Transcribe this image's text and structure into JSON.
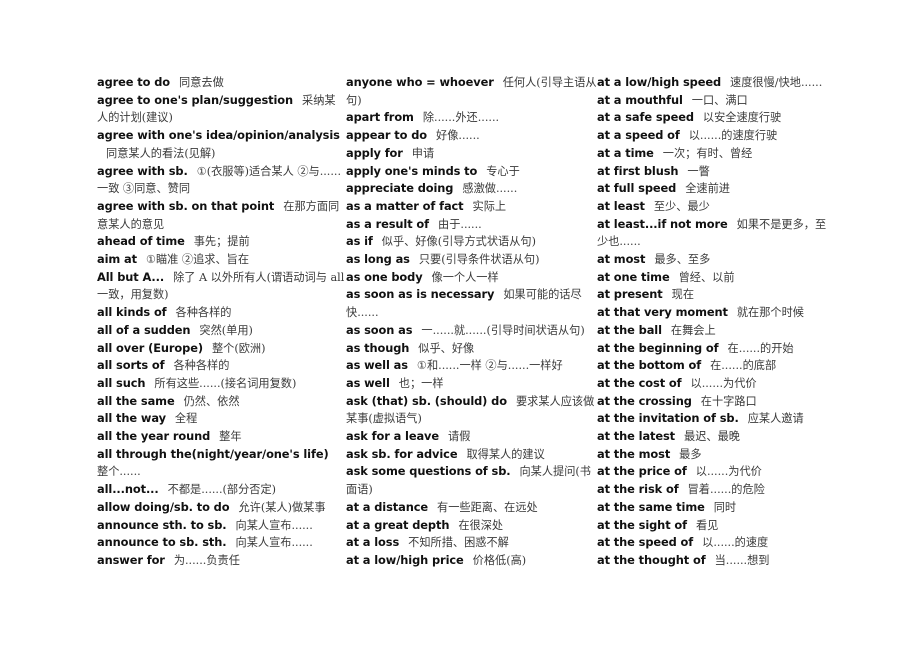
{
  "document": {
    "page_background": "#ffffff",
    "english_color": "#111111",
    "chinese_color": "#3a3a3a",
    "columns": [
      {
        "id": "column-1",
        "entries": [
          {
            "en": "agree to do",
            "zh": "同意去做"
          },
          {
            "en": "agree to one's plan/suggestion",
            "zh": "采纳某人的计划(建议)"
          },
          {
            "en": "agree with one's idea/opinion/analysis",
            "zh": "同意某人的看法(见解)"
          },
          {
            "en": "agree with sb.",
            "zh": "①(衣服等)适合某人  ②与......一致 ③同意、赞同"
          },
          {
            "en": "agree with sb. on that point",
            "zh": "在那方面同意某人的意见"
          },
          {
            "en": "ahead of time",
            "zh": "事先；提前"
          },
          {
            "en": "aim at",
            "zh": "①瞄准 ②追求、旨在"
          },
          {
            "en": "All but A...",
            "zh": "除了 A 以外所有人(谓语动词与 all 一致，用复数)"
          },
          {
            "en": "all kinds of",
            "zh": "各种各样的"
          },
          {
            "en": "all of a sudden",
            "zh": "突然(单用)"
          },
          {
            "en": "all over (Europe)",
            "zh": "整个(欧洲)"
          },
          {
            "en": "all sorts of",
            "zh": "各种各样的"
          },
          {
            "en": "all such",
            "zh": "所有这些......(接名词用复数)"
          },
          {
            "en": "all the same",
            "zh": "仍然、依然"
          },
          {
            "en": "all the way",
            "zh": "全程"
          },
          {
            "en": "all the year round",
            "zh": "整年"
          },
          {
            "en": "all through the(night/year/one's life)",
            "zh": "整个......"
          },
          {
            "en": "all...not...",
            "zh": "不都是......(部分否定)"
          },
          {
            "en": "allow doing/sb. to do",
            "zh": "允许(某人)做某事"
          },
          {
            "en": "announce sth. to sb.",
            "zh": "向某人宣布......"
          },
          {
            "en": "announce to sb. sth.",
            "zh": "向某人宣布......"
          },
          {
            "en": "answer for",
            "zh": "为......负责任"
          }
        ]
      },
      {
        "id": "column-2",
        "entries": [
          {
            "en": "anyone who = whoever",
            "zh": "任何人(引导主语从句)"
          },
          {
            "en": "apart from",
            "zh": "除......外还......"
          },
          {
            "en": "appear to do",
            "zh": "好像......"
          },
          {
            "en": "apply for",
            "zh": "申请"
          },
          {
            "en": "apply one's minds to",
            "zh": "专心于"
          },
          {
            "en": "appreciate doing",
            "zh": "感激做......"
          },
          {
            "en": "as a matter of fact",
            "zh": "实际上"
          },
          {
            "en": "as a result of",
            "zh": "由于......"
          },
          {
            "en": "as if",
            "zh": "似乎、好像(引导方式状语从句)"
          },
          {
            "en": "as long as",
            "zh": "只要(引导条件状语从句)"
          },
          {
            "en": "as one body",
            "zh": "像一个人一样"
          },
          {
            "en": "as soon as is necessary",
            "zh": "如果可能的话尽快......"
          },
          {
            "en": "as soon as",
            "zh": "一......就......(引导时间状语从句)"
          },
          {
            "en": "as though",
            "zh": "似乎、好像"
          },
          {
            "en": "as well as",
            "zh": "①和......一样 ②与......一样好"
          },
          {
            "en": "as well",
            "zh": "也；一样"
          },
          {
            "en": "ask (that) sb. (should) do",
            "zh": "要求某人应该做某事(虚拟语气)"
          },
          {
            "en": "ask for a leave",
            "zh": "请假"
          },
          {
            "en": "ask sb. for advice",
            "zh": "取得某人的建议"
          },
          {
            "en": "ask some questions of sb.",
            "zh": "向某人提问(书面语)"
          },
          {
            "en": "at a distance",
            "zh": "有一些距离、在远处"
          },
          {
            "en": "at a great depth",
            "zh": "在很深处"
          },
          {
            "en": "at a loss",
            "zh": "不知所措、困惑不解"
          },
          {
            "en": "at a low/high price",
            "zh": "价格低(高)"
          }
        ]
      },
      {
        "id": "column-3",
        "entries": [
          {
            "en": "at a low/high speed",
            "zh": "速度很慢/快地......"
          },
          {
            "en": "at a mouthful",
            "zh": "一口、满口"
          },
          {
            "en": "at a safe speed",
            "zh": "以安全速度行驶"
          },
          {
            "en": "at a speed of",
            "zh": "以......的速度行驶"
          },
          {
            "en": "at a time",
            "zh": "一次；有时、曾经"
          },
          {
            "en": "at first blush",
            "zh": "一瞥"
          },
          {
            "en": "at full speed",
            "zh": "全速前进"
          },
          {
            "en": "at least",
            "zh": "至少、最少"
          },
          {
            "en": "at least...if not more",
            "zh": "如果不是更多，至少也......"
          },
          {
            "en": "at most",
            "zh": "最多、至多"
          },
          {
            "en": "at one time",
            "zh": "曾经、以前"
          },
          {
            "en": "at present",
            "zh": "现在"
          },
          {
            "en": "at that very moment",
            "zh": "就在那个时候"
          },
          {
            "en": "at the ball",
            "zh": "在舞会上"
          },
          {
            "en": "at the beginning of",
            "zh": "在......的开始"
          },
          {
            "en": "at the bottom of",
            "zh": "在......的底部"
          },
          {
            "en": "at the cost of",
            "zh": "以......为代价"
          },
          {
            "en": "at the crossing",
            "zh": "在十字路口"
          },
          {
            "en": "at the invitation of sb.",
            "zh": "应某人邀请"
          },
          {
            "en": "at the latest",
            "zh": "最迟、最晚"
          },
          {
            "en": "at the most",
            "zh": "最多"
          },
          {
            "en": "at the price of",
            "zh": "以......为代价"
          },
          {
            "en": "at the risk of",
            "zh": "冒着......的危险"
          },
          {
            "en": "at the same time",
            "zh": "同时"
          },
          {
            "en": "at the sight of",
            "zh": "看见"
          },
          {
            "en": "at the speed of",
            "zh": "以......的速度"
          },
          {
            "en": "at the thought of",
            "zh": "当......想到"
          }
        ]
      }
    ]
  }
}
